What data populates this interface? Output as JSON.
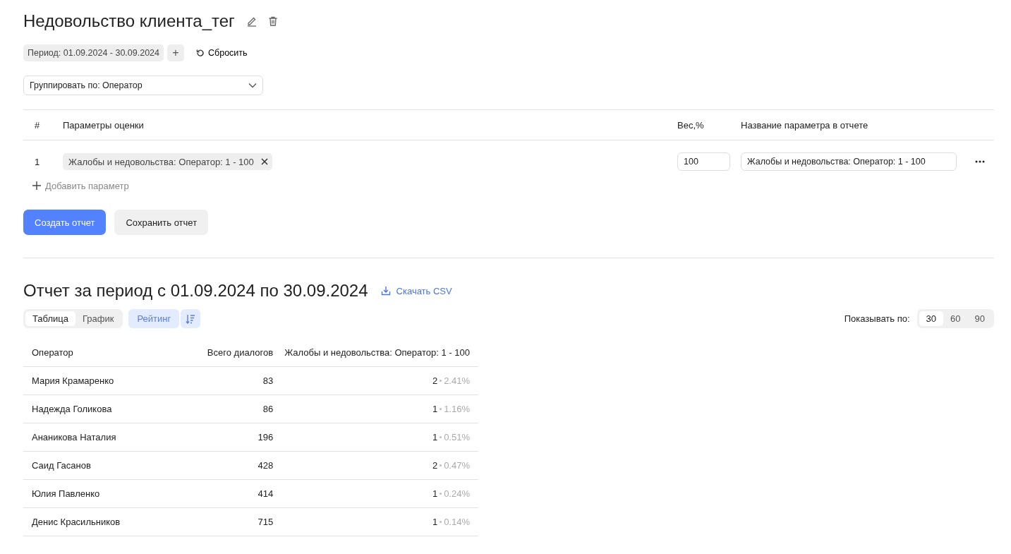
{
  "title": "Недовольство клиента_тег",
  "filters": {
    "period": "Период: 01.09.2024 - 30.09.2024",
    "add": "+",
    "reset": "Сбросить"
  },
  "group_by": {
    "value": "Группировать по: Оператор"
  },
  "params_table": {
    "columns": [
      "#",
      "Параметры оценки",
      "Вес,%",
      "Название параметра в отчете"
    ],
    "rows": [
      {
        "index": "1",
        "tag": "Жалобы и недовольства:  Оператор: 1 - 100",
        "weight": "100",
        "report_name": "Жалобы и недовольства: Оператор: 1 - 100"
      }
    ],
    "add_param": "Добавить параметр"
  },
  "actions": [
    {
      "label": "Создать отчет",
      "kind": "primary"
    },
    {
      "label": "Сохранить отчет",
      "kind": "secondary"
    }
  ],
  "report": {
    "title": "Отчет за период с 01.09.2024 по 30.09.2024",
    "download": "Скачать CSV",
    "view_tabs": [
      {
        "label": "Таблица",
        "selected": true
      },
      {
        "label": "График",
        "selected": false
      }
    ],
    "rating": {
      "label": "Рейтинг",
      "selected": true
    },
    "page_size": {
      "label": "Показывать по:",
      "options": [
        {
          "label": "30",
          "selected": true
        },
        {
          "label": "60",
          "selected": false
        },
        {
          "label": "90",
          "selected": false
        }
      ]
    },
    "columns": [
      "Оператор",
      "Всего диалогов",
      "Жалобы и недовольства: Оператор: 1 - 100"
    ],
    "rows": [
      {
        "name": "Мария Крамаренко",
        "total": "83",
        "count": "2",
        "share": "2.41%"
      },
      {
        "name": "Надежда Голикова",
        "total": "86",
        "count": "1",
        "share": "1.16%"
      },
      {
        "name": "Ананикова Наталия",
        "total": "196",
        "count": "1",
        "share": "0.51%"
      },
      {
        "name": "Саид Гасанов",
        "total": "428",
        "count": "2",
        "share": "0.47%"
      },
      {
        "name": "Юлия Павленко",
        "total": "414",
        "count": "1",
        "share": "0.24%"
      },
      {
        "name": "Денис Красильников",
        "total": "715",
        "count": "1",
        "share": "0.14%"
      }
    ]
  }
}
